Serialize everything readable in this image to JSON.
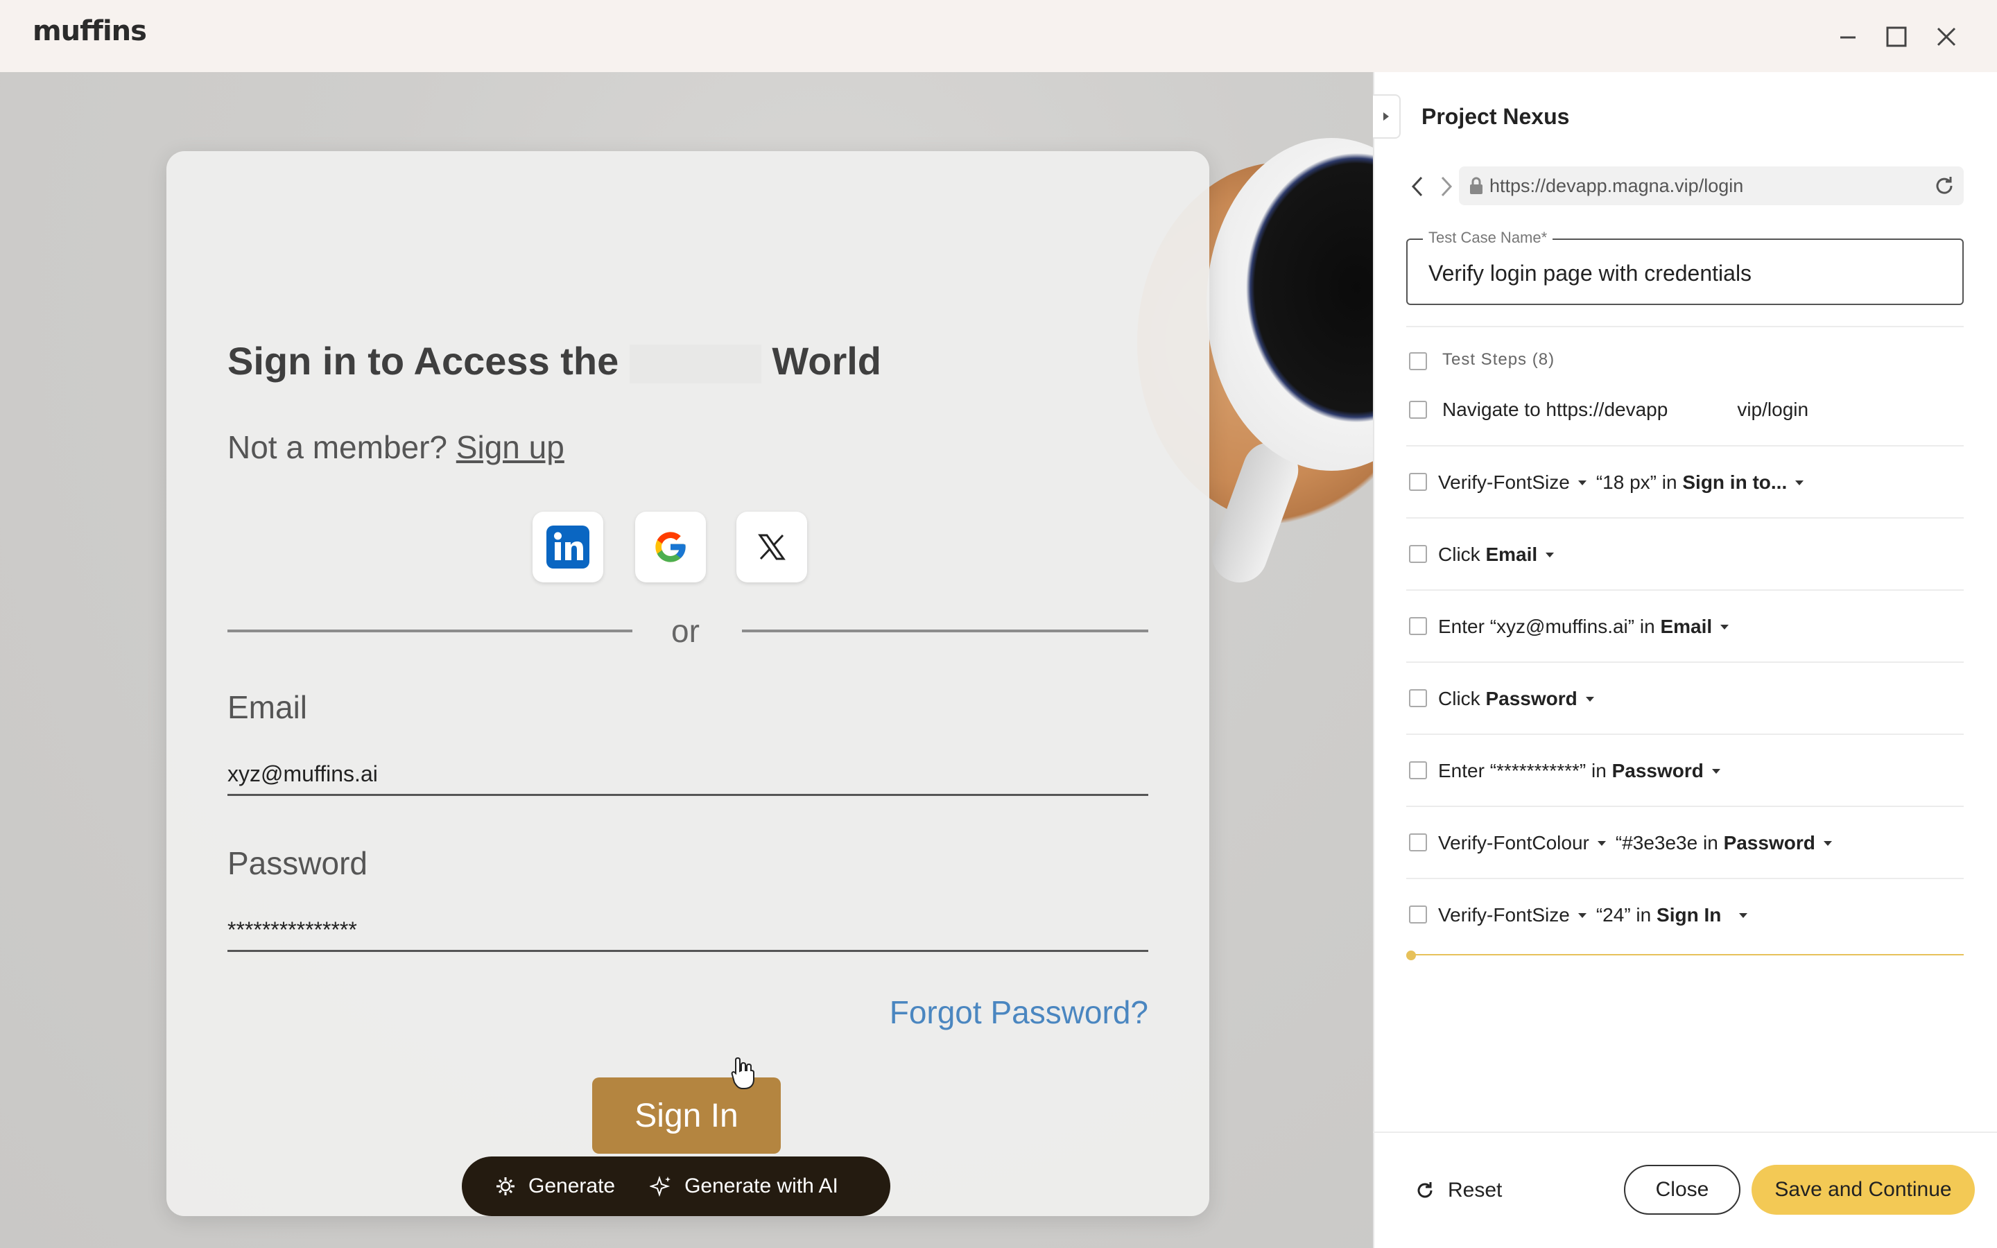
{
  "app": {
    "logo": "muffins"
  },
  "window": {
    "minimize_icon": "minimize-icon",
    "maximize_icon": "maximize-icon",
    "close_icon": "close-icon"
  },
  "login": {
    "title_start": "Sign in to Access the",
    "title_end": "World",
    "member_text": "Not a member?",
    "signup_link": "Sign up",
    "social": [
      "linkedin-icon",
      "google-icon",
      "x-icon"
    ],
    "or": "or",
    "email_label": "Email",
    "email_value": "xyz@muffins.ai",
    "password_label": "Password",
    "password_value": "***************",
    "forgot": "Forgot Password?",
    "signin": "Sign In",
    "brand_color": "#b48540"
  },
  "generate_bar": {
    "generate": "Generate",
    "generate_ai": "Generate with AI"
  },
  "panel": {
    "project": "Project Nexus",
    "url": "https://devapp.magna.vip/login",
    "test_case_label": "Test Case Name*",
    "test_case_value": "Verify login page with credentials",
    "steps_header": "Test Steps (8)",
    "steps": [
      {
        "pre": "Navigate to https://devapp",
        "mid": "",
        "post": "vip/login",
        "bold": "",
        "tail": ""
      },
      {
        "pre": "Verify-FontSize",
        "mid": "“18 px” in",
        "bold": "Sign in to...",
        "tail": ""
      },
      {
        "pre": "Click",
        "bold": "Email"
      },
      {
        "pre": "Enter “xyz@muffins.ai” in",
        "bold": "Email"
      },
      {
        "pre": "Click",
        "bold": "Password"
      },
      {
        "pre": "Enter “***********” in",
        "bold": "Password"
      },
      {
        "pre": "Verify-FontColour",
        "mid": "“#3e3e3e in",
        "bold": "Password"
      },
      {
        "pre": "Verify-FontSize",
        "mid": "“24” in",
        "bold": "Sign In"
      }
    ],
    "reset": "Reset",
    "close": "Close",
    "save": "Save and Continue",
    "accent_color": "#f3c955"
  }
}
